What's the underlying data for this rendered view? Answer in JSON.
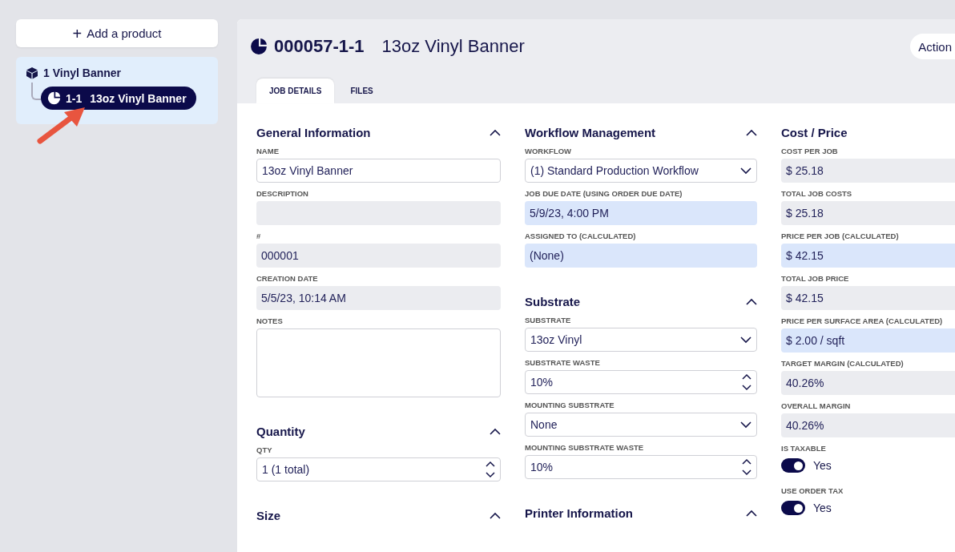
{
  "sidebar": {
    "add_button": {
      "icon": "+",
      "label": "Add a product"
    },
    "tree": [
      {
        "label": "1 Vinyl Banner",
        "selected": false,
        "children": [
          {
            "number": "1-1",
            "label": "13oz Vinyl Banner",
            "selected": true
          }
        ]
      }
    ]
  },
  "header": {
    "number": "000057-1-1",
    "title": "13oz Vinyl Banner",
    "actions_button": "Action"
  },
  "tabs": [
    {
      "label": "JOB DETAILS",
      "selected": true
    },
    {
      "label": "FILES",
      "selected": false
    }
  ],
  "columns": [
    {
      "sections": [
        {
          "title": "General Information",
          "expanded": true,
          "fields": [
            {
              "label": "NAME",
              "kind": "text",
              "value": "13oz Vinyl Banner"
            },
            {
              "label": "DESCRIPTION",
              "kind": "readonly"
            },
            {
              "label": "#",
              "kind": "readonly",
              "value": "000001"
            },
            {
              "label": "CREATION DATE",
              "kind": "readonly",
              "value": "5/5/23, 10:14 AM"
            },
            {
              "label": "NOTES",
              "kind": "textarea"
            }
          ]
        },
        {
          "title": "Quantity",
          "expanded": true,
          "fields": [
            {
              "label": "QTY",
              "kind": "spinner",
              "value": "1  (1 total)"
            }
          ]
        },
        {
          "title": "Size",
          "expanded": true
        }
      ]
    },
    {
      "sections": [
        {
          "title": "Workflow Management",
          "expanded": true,
          "fields": [
            {
              "label": "WORKFLOW",
              "kind": "select",
              "value": "(1) Standard Production Workflow"
            },
            {
              "label": "JOB DUE DATE (USING ORDER DUE DATE)",
              "kind": "calculated",
              "value": "5/9/23, 4:00 PM"
            },
            {
              "label": "ASSIGNED TO (CALCULATED)",
              "kind": "calculated",
              "value": "(None)"
            }
          ]
        },
        {
          "title": "Substrate",
          "expanded": true,
          "fields": [
            {
              "label": "SUBSTRATE",
              "kind": "select",
              "value": "13oz Vinyl"
            },
            {
              "label": "SUBSTRATE WASTE",
              "kind": "spinner",
              "value": "10%"
            },
            {
              "label": "MOUNTING SUBSTRATE",
              "kind": "select",
              "value": "None"
            },
            {
              "label": "MOUNTING SUBSTRATE WASTE",
              "kind": "spinner",
              "value": "10%"
            }
          ]
        },
        {
          "title": "Printer Information",
          "expanded": true
        }
      ]
    },
    {
      "sections": [
        {
          "title": "Cost / Price",
          "fields": [
            {
              "label": "COST PER JOB",
              "kind": "readonly",
              "value": "$ 25.18"
            },
            {
              "label": "TOTAL JOB COSTS",
              "kind": "readonly",
              "value": "$ 25.18"
            },
            {
              "label": "PRICE PER JOB (CALCULATED)",
              "kind": "calculated",
              "value": "$ 42.15"
            },
            {
              "label": "TOTAL JOB PRICE",
              "kind": "readonly",
              "value": "$ 42.15"
            },
            {
              "label": "PRICE PER SURFACE AREA (CALCULATED)",
              "kind": "calculated",
              "value": "$ 2.00 / sqft"
            },
            {
              "label": "TARGET MARGIN (CALCULATED)",
              "kind": "readonly",
              "value": "40.26%"
            },
            {
              "label": "OVERALL MARGIN",
              "kind": "readonly",
              "value": "40.26%"
            },
            {
              "label": "IS TAXABLE",
              "kind": "toggle",
              "on": true,
              "value": "Yes"
            },
            {
              "label": "USE ORDER TAX",
              "kind": "toggle",
              "on": true,
              "value": "Yes"
            }
          ]
        }
      ]
    }
  ]
}
